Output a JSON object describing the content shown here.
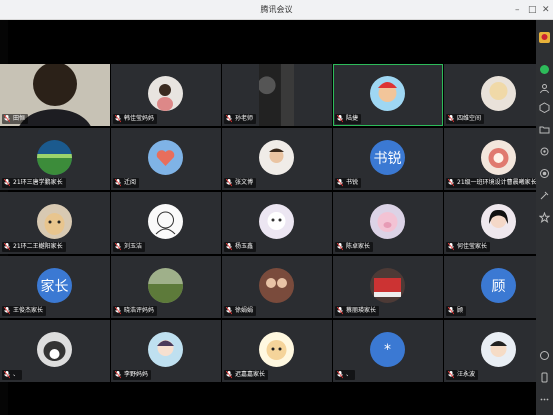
{
  "window": {
    "title": "腾讯会议"
  },
  "participants": [
    {
      "name": "田恒",
      "avatar": "cam-teacher"
    },
    {
      "name": "韩佳莹妈妈",
      "avatar": "photo-girl"
    },
    {
      "name": "孙老师",
      "avatar": "cam-dark"
    },
    {
      "name": "陆捷",
      "avatar": "cartoon-boy"
    },
    {
      "name": "四维空间",
      "avatar": "photo-blonde"
    },
    {
      "name": "21环三唐学鹏家长",
      "avatar": "landscape-earth"
    },
    {
      "name": "迁阅",
      "avatar": "photo-heart"
    },
    {
      "name": "张文博",
      "avatar": "photo-kid"
    },
    {
      "name": "书锐",
      "avatar": "text",
      "avatar_text": "书锐"
    },
    {
      "name": "21级一班环境设计曹晨曦家长",
      "avatar": "photo-dessert"
    },
    {
      "name": "21环二王樾阳家长",
      "avatar": "photo-dog"
    },
    {
      "name": "刘玉洁",
      "avatar": "drawing-girl"
    },
    {
      "name": "杨玉鑫",
      "avatar": "photo-cartoon"
    },
    {
      "name": "陈卓家长",
      "avatar": "photo-pig"
    },
    {
      "name": "何佳莹家长",
      "avatar": "photo-blackhair"
    },
    {
      "name": "王俊杰家长",
      "avatar": "text",
      "avatar_text": "家长"
    },
    {
      "name": "晓浩评妈妈",
      "avatar": "photo-field"
    },
    {
      "name": "徐娟娟",
      "avatar": "photo-couple"
    },
    {
      "name": "蔡丽瑛家长",
      "avatar": "photo-building"
    },
    {
      "name": "顾",
      "avatar": "text",
      "avatar_text": "顾"
    },
    {
      "name": "、",
      "avatar": "photo-dog-bw"
    },
    {
      "name": "李野妈妈",
      "avatar": "photo-anime-girl"
    },
    {
      "name": "迟嘉嘉家长",
      "avatar": "photo-cartoon-face"
    },
    {
      "name": "、",
      "avatar": "text",
      "avatar_text": "*"
    },
    {
      "name": "汪永波",
      "avatar": "photo-anime-boy"
    }
  ],
  "speaking_index": 3,
  "colors": {
    "tile_bg": "#2b2d31",
    "speaking": "#2dbb5a",
    "text_avatar": "#3b79d3"
  }
}
